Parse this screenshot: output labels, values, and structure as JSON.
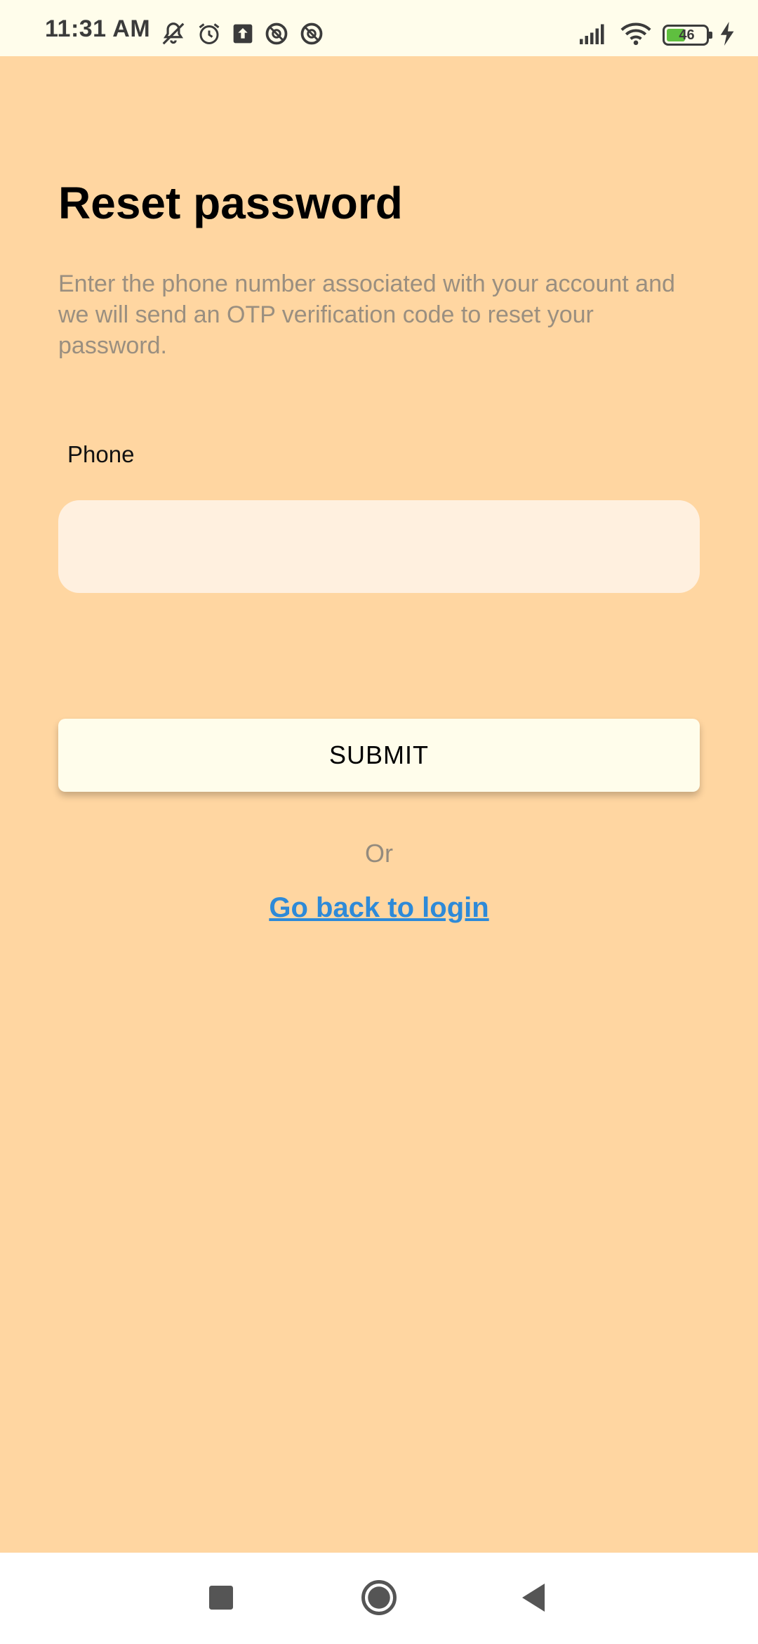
{
  "status_bar": {
    "time": "11:31 AM",
    "battery_level": "46",
    "left_icons": [
      "mute-icon",
      "alarm-icon",
      "upload-icon",
      "vpn-icon",
      "vpn-icon"
    ],
    "right_icons": [
      "signal-icon",
      "wifi-icon",
      "battery-icon",
      "charging-icon"
    ]
  },
  "screen": {
    "title": "Reset password",
    "description": "Enter the phone number associated with your account and we will send an OTP verification code to reset your password.",
    "phone_label": "Phone",
    "phone_value": "",
    "phone_placeholder": "",
    "submit_label": "SUBMIT",
    "or_text": "Or",
    "login_link": "Go back to login"
  },
  "nav_bar": {
    "buttons": [
      "recents-square-icon",
      "home-circle-icon",
      "back-triangle-icon"
    ]
  },
  "colors": {
    "background": "#FFD6A1",
    "status_bar": "#FFFDEB",
    "input_background": "#FFF0DF",
    "button_background": "#FFFDEB",
    "link": "#2E8AD8",
    "description_text": "#9A8F80"
  }
}
